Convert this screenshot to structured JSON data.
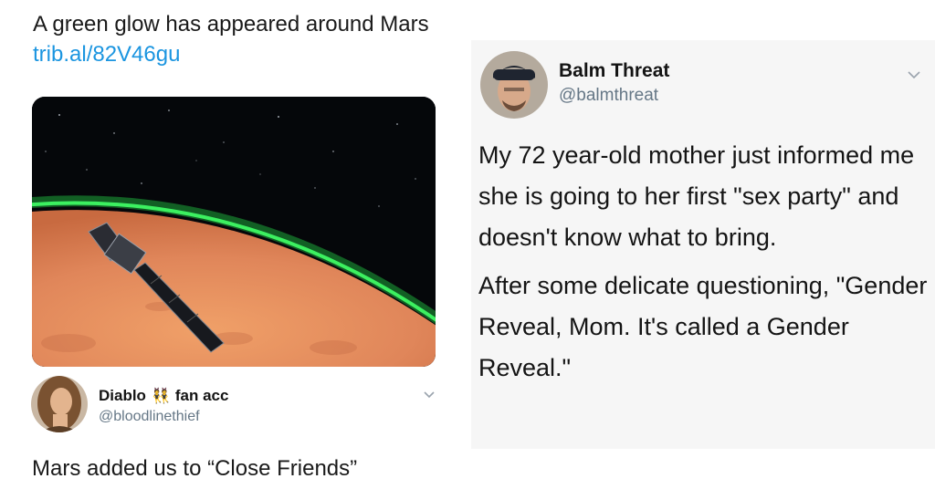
{
  "left": {
    "tweet_text": "A green glow has appeared around Mars ",
    "tweet_link": "trib.al/82V46gu",
    "image_icon": "mars-orbiter-image",
    "reply": {
      "name": "Diablo",
      "emoji": "👯",
      "name_suffix": "fan acc",
      "handle": "@bloodlinethief",
      "text": "Mars added us to “Close Friends”"
    }
  },
  "right": {
    "name": "Balm Threat",
    "handle": "@balmthreat",
    "paragraph1": "My 72 year-old mother just informed me she is going to her first \"sex party\" and doesn't know what to bring.",
    "paragraph2": "After some delicate questioning, \"Gender Reveal, Mom. It's called a Gender Reveal.\""
  },
  "colors": {
    "link": "#1b95e0",
    "handle": "#657786",
    "right_background": "#f6f6f6"
  }
}
